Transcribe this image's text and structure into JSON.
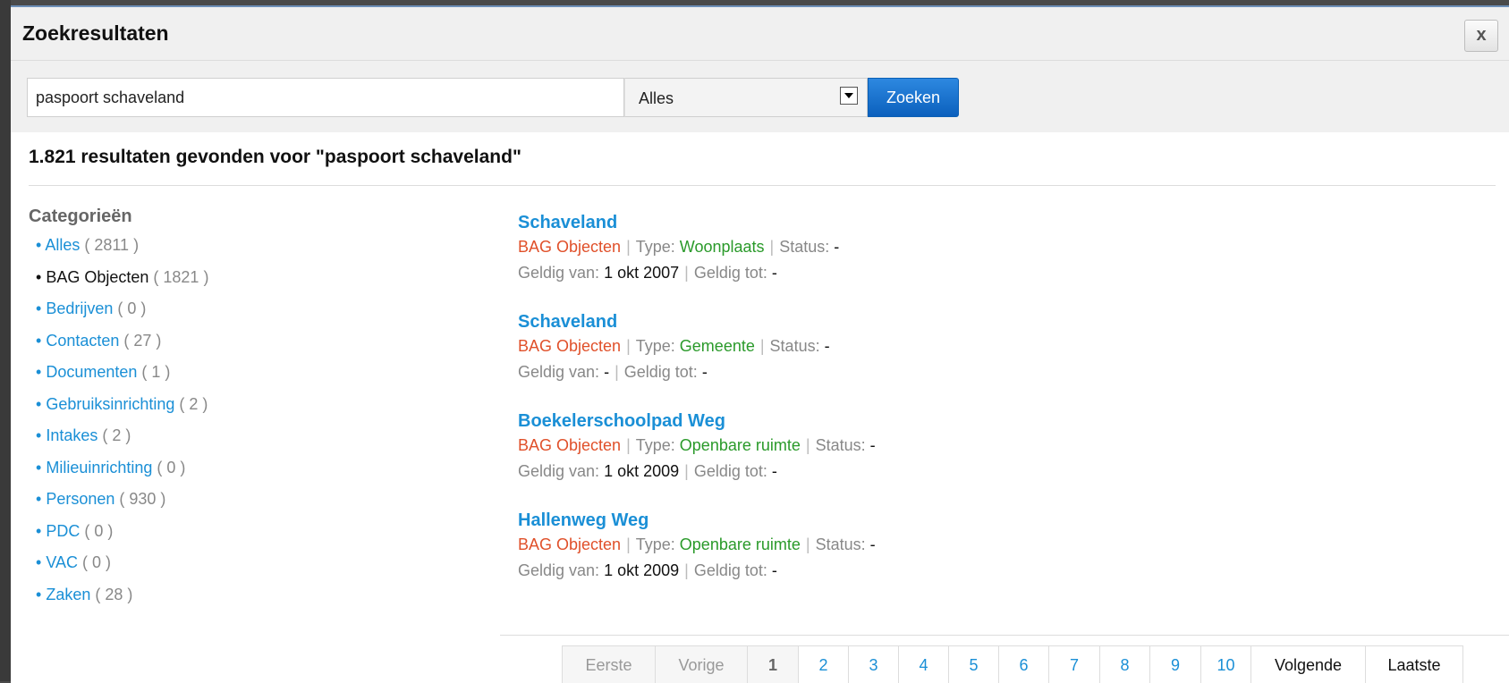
{
  "dialog": {
    "title": "Zoekresultaten",
    "close_label": "x"
  },
  "search": {
    "query": "paspoort schaveland",
    "scope": "Alles",
    "button_label": "Zoeken"
  },
  "summary": "1.821 resultaten gevonden voor \"paspoort schaveland\"",
  "categories": {
    "title": "Categorieën",
    "items": [
      {
        "label": "Alles",
        "count": "( 2811 )"
      },
      {
        "label": "BAG Objecten",
        "count": "( 1821 )"
      },
      {
        "label": "Bedrijven",
        "count": "( 0 )"
      },
      {
        "label": "Contacten",
        "count": "( 27 )"
      },
      {
        "label": "Documenten",
        "count": "( 1 )"
      },
      {
        "label": "Gebruiksinrichting",
        "count": "( 2 )"
      },
      {
        "label": "Intakes",
        "count": "( 2 )"
      },
      {
        "label": "Milieuinrichting",
        "count": "( 0 )"
      },
      {
        "label": "Personen",
        "count": "( 930 )"
      },
      {
        "label": "PDC",
        "count": "( 0 )"
      },
      {
        "label": "VAC",
        "count": "( 0 )"
      },
      {
        "label": "Zaken",
        "count": "( 28 )"
      }
    ]
  },
  "labels": {
    "bullet": "•",
    "separator": "|",
    "type_label": "Type:",
    "status_label": "Status:",
    "valid_from_label": "Geldig van:",
    "valid_to_label": "Geldig tot:"
  },
  "results": [
    {
      "title": "Schaveland",
      "source": "BAG Objecten",
      "type": "Woonplaats",
      "status": "-",
      "valid_from": "1 okt 2007",
      "valid_to": "-"
    },
    {
      "title": "Schaveland",
      "source": "BAG Objecten",
      "type": "Gemeente",
      "status": "-",
      "valid_from": "-",
      "valid_to": "-"
    },
    {
      "title": "Boekelerschoolpad Weg",
      "source": "BAG Objecten",
      "type": "Openbare ruimte",
      "status": "-",
      "valid_from": "1 okt 2009",
      "valid_to": "-"
    },
    {
      "title": "Hallenweg Weg",
      "source": "BAG Objecten",
      "type": "Openbare ruimte",
      "status": "-",
      "valid_from": "1 okt 2009",
      "valid_to": "-"
    }
  ],
  "pagination": {
    "first": "Eerste",
    "prev": "Vorige",
    "pages": [
      "1",
      "2",
      "3",
      "4",
      "5",
      "6",
      "7",
      "8",
      "9",
      "10"
    ],
    "next": "Volgende",
    "last": "Laatste"
  }
}
